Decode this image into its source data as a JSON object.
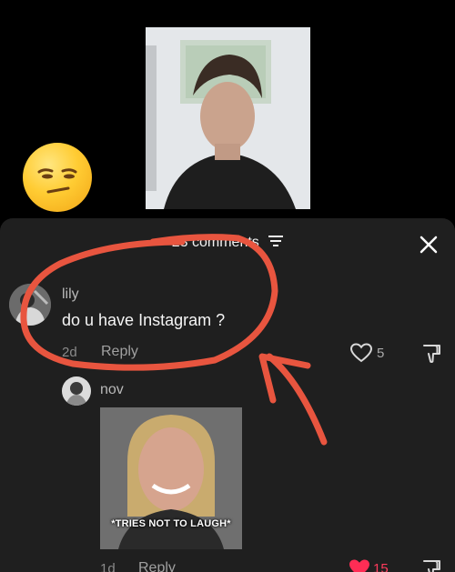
{
  "comments_header": {
    "count_label": "23 comments"
  },
  "comments": [
    {
      "username": "lily",
      "text": "do u have Instagram ?",
      "time": "2d",
      "reply_label": "Reply",
      "likes": "5"
    }
  ],
  "reply": {
    "username": "nov",
    "image_caption": "*TRIES NOT TO LAUGH*",
    "time": "1d",
    "reply_label": "Reply",
    "likes": "15"
  },
  "colors": {
    "sheet_bg": "#1f1f1f",
    "annotation_red": "#e8553f",
    "liked_heart": "#ff2d55"
  }
}
